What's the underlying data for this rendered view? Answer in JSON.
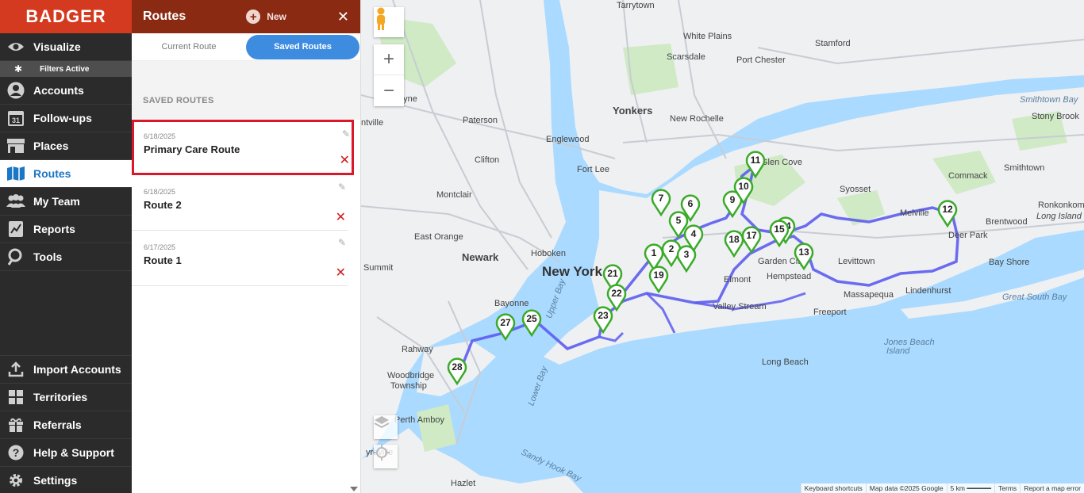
{
  "app": {
    "logo_text": "BADGER",
    "accent_color": "#d43a1f",
    "panel_header_color": "#8b2a12",
    "active_color": "#1b76c5"
  },
  "nav": {
    "items": [
      {
        "label": "Visualize",
        "icon": "eye-icon"
      },
      {
        "label": "Filters Active",
        "icon": "filter-icon"
      },
      {
        "label": "Accounts",
        "icon": "person-icon"
      },
      {
        "label": "Follow-ups",
        "icon": "calendar-icon"
      },
      {
        "label": "Places",
        "icon": "store-icon"
      },
      {
        "label": "Routes",
        "icon": "map-icon",
        "active": true
      },
      {
        "label": "My Team",
        "icon": "team-icon"
      },
      {
        "label": "Reports",
        "icon": "report-icon"
      },
      {
        "label": "Tools",
        "icon": "tools-icon"
      }
    ],
    "bottom_items": [
      {
        "label": "Import Accounts",
        "icon": "upload-icon"
      },
      {
        "label": "Territories",
        "icon": "grid-icon"
      },
      {
        "label": "Referrals",
        "icon": "gift-icon"
      },
      {
        "label": "Help & Support",
        "icon": "help-icon"
      },
      {
        "label": "Settings",
        "icon": "gear-icon"
      }
    ],
    "calendar_day": "31"
  },
  "panel": {
    "title": "Routes",
    "new_label": "New",
    "close_glyph": "✕",
    "tabs": {
      "current": "Current Route",
      "saved": "Saved Routes"
    },
    "saved_heading": "SAVED ROUTES",
    "routes": [
      {
        "date": "6/18/2025",
        "name": "Primary Care Route"
      },
      {
        "date": "6/18/2025",
        "name": "Route 2"
      },
      {
        "date": "6/17/2025",
        "name": "Route 1"
      }
    ]
  },
  "map": {
    "zoom_in": "+",
    "zoom_out": "−",
    "pins": [
      "1",
      "2",
      "3",
      "4",
      "5",
      "6",
      "7",
      "9",
      "10",
      "11",
      "12",
      "13",
      "14",
      "15",
      "17",
      "18",
      "19",
      "21",
      "22",
      "23",
      "25",
      "27",
      "28"
    ],
    "labels": {
      "tarrytown": "Tarrytown",
      "stamford": "Stamford",
      "white_plains": "White Plains",
      "port_chester": "Port Chester",
      "scarsdale": "Scarsdale",
      "wayne": "Wayne",
      "yonkers": "Yonkers",
      "new_rochelle": "New Rochelle",
      "paterson": "Paterson",
      "smithtown_bay": "Smithtown Bay",
      "stony_brook": "Stony Brook",
      "englewood": "Englewood",
      "clifton": "Clifton",
      "fort_lee": "Fort Lee",
      "glen_cove": "Glen Cove",
      "commack": "Commack",
      "smithtown": "Smithtown",
      "montclair": "Montclair",
      "syosset": "Syosset",
      "melville": "Melville",
      "brentwood": "Brentwood",
      "deer_park": "Deer Park",
      "east_orange": "East Orange",
      "newark": "Newark",
      "hoboken": "Hoboken",
      "new_york": "New York",
      "summit": "Summit",
      "garden_city": "Garden City",
      "levittown": "Levittown",
      "bay_shore": "Bay Shore",
      "elmont": "Elmont",
      "hempstead": "Hempstead",
      "bayonne": "Bayonne",
      "valley_stream": "Valley Stream",
      "massapequa": "Massapequa",
      "lindenhurst": "Lindenhurst",
      "great_south_bay": "Great South Bay",
      "upper_bay": "Upper Bay",
      "freeport": "Freeport",
      "rahway": "Rahway",
      "jones_beach": "Jones Beach",
      "island": "Island",
      "long_beach": "Long Beach",
      "woodbridge": "Woodbridge",
      "township": "Township",
      "lower_bay": "Lower Bay",
      "perth_amboy": "Perth Amboy",
      "sayreville": "yreville",
      "sandy_hook_bay": "Sandy Hook Bay",
      "hazlet": "Hazlet",
      "long_island": "Long Island",
      "ronkonkoma": "Ronkonkoma",
      "tville": "ntville"
    },
    "attribution": [
      "Keyboard shortcuts",
      "Map data ©2025 Google",
      "5 km",
      "Terms",
      "Report a map error"
    ]
  }
}
